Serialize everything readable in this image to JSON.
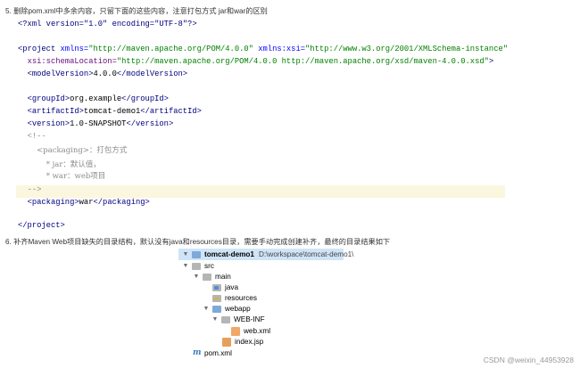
{
  "steps": {
    "step5": "5. 删除pom.xml中多余内容，只留下面的这些内容，注意打包方式 jar和war的区别",
    "step6": "6. 补齐Maven Web项目缺失的目录结构，默认没有java和resources目录，需要手动完成创建补齐，最终的目录结果如下"
  },
  "code": {
    "xml_decl": "<?xml version=\"1.0\" encoding=\"UTF-8\"?>",
    "project_open_tag": "<project",
    "xmlns_attr": " xmlns=",
    "xmlns_val": "\"http://maven.apache.org/POM/4.0.0\"",
    "xmlns_xsi_attr": " xmlns:xsi=",
    "xmlns_xsi_val": "\"http://www.w3.org/2001/XMLSchema-instance\"",
    "schema_attr": "xsi:schemaLocation=",
    "schema_val": "\"http://maven.apache.org/POM/4.0.0 http://maven.apache.org/xsd/maven-4.0.0.xsd\"",
    "schema_close": ">",
    "model_open": "<modelVersion>",
    "model_value": "4.0.0",
    "model_close": "</modelVersion>",
    "group_open": "<groupId>",
    "group_value": "org.example",
    "group_close": "</groupId>",
    "artifact_open": "<artifactId>",
    "artifact_value": "tomcat-demo1",
    "artifact_close": "</artifactId>",
    "version_open": "<version>",
    "version_value": "1.0-SNAPSHOT",
    "version_close": "</version>",
    "comment_open": "<!--",
    "comment_line1": "<packaging>：打包方式",
    "comment_line2": "* jar：默认值，",
    "comment_line3": "* war：web项目",
    "comment_close": "-->",
    "packaging_open": "<packaging>",
    "packaging_value": "war",
    "packaging_close": "</packaging>",
    "project_close": "</project>"
  },
  "tree": {
    "project_name": "tomcat-demo1",
    "project_path": "D:\\workspace\\tomcat-demo1\\",
    "items": [
      {
        "label": "src"
      },
      {
        "label": "main"
      },
      {
        "label": "java"
      },
      {
        "label": "resources"
      },
      {
        "label": "webapp"
      },
      {
        "label": "WEB-INF"
      },
      {
        "label": "web.xml"
      },
      {
        "label": "index.jsp"
      },
      {
        "label": "pom.xml"
      }
    ]
  },
  "watermark": "CSDN @weixin_44953928",
  "colors": {
    "tag": "#000080",
    "attr_value": "#008000",
    "comment": "#8c8c8c",
    "highlight_line": "#fbf6de",
    "tree_header": "#cfe4f7"
  }
}
